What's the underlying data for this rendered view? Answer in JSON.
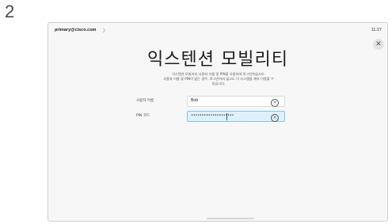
{
  "step_number": "2",
  "header": {
    "account": "primary@cisco.com",
    "chevron": "〉",
    "time": "11:27",
    "close_icon": "close-icon"
  },
  "title": "익스텐션 모빌리티",
  "description": {
    "line1": "익스텐션 모빌리티 사용자 이름 및 PIN을 사용하여 로그인하십시오.",
    "line2": "사용자 이름 및 PIN이 없는 경우, 로그인하지 않고도 이 시스템을 계속 이용할 수",
    "line3": "있습니다."
  },
  "form": {
    "username_label": "사용자 이름",
    "username_value": "Bob",
    "pin_label": "PIN 코드",
    "pin_value": "••••••••••••••••••••",
    "clear_glyph": "×"
  }
}
